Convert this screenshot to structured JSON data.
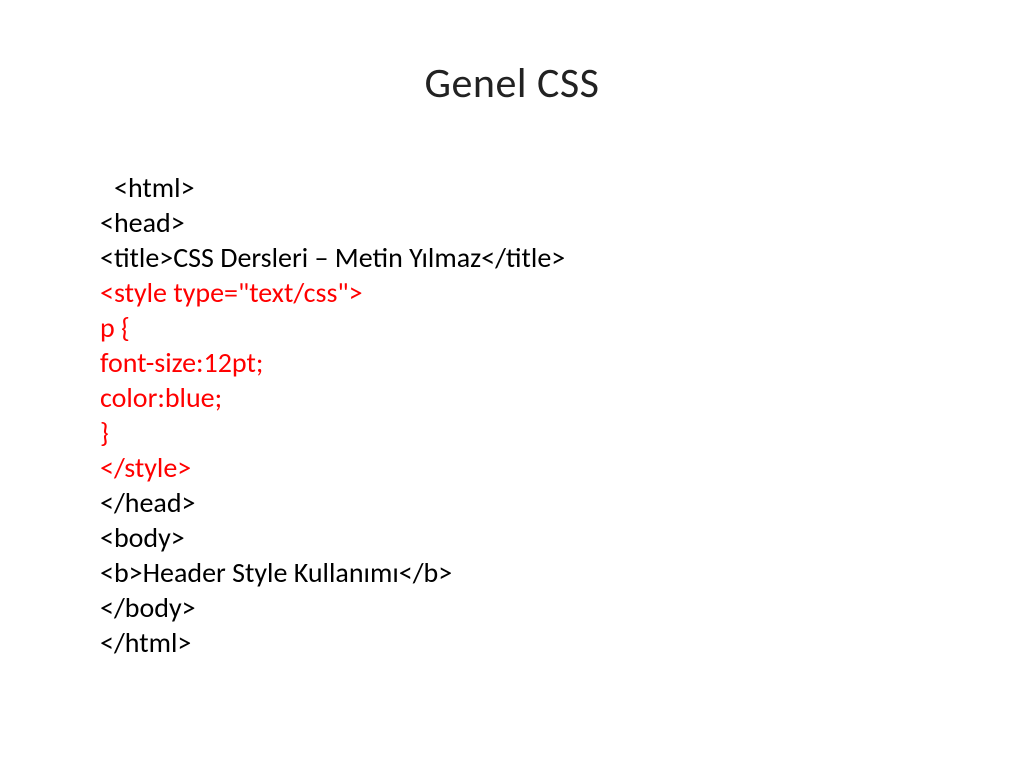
{
  "title": "Genel CSS",
  "code": {
    "l1": "<html>",
    "l2": "<head>",
    "l3": "<title>CSS Dersleri – Metin Yılmaz</title>",
    "l4": "<style type=\"text/css\">",
    "l5": "p {",
    "l6": "font-size:12pt;",
    "l7": "color:blue;",
    "l8": "}",
    "l9": "</style>",
    "l10": "</head>",
    "l11": "<body>",
    "l12": "<b>Header Style Kullanımı</b>",
    "l13": "</body>",
    "l14": "</html>"
  }
}
